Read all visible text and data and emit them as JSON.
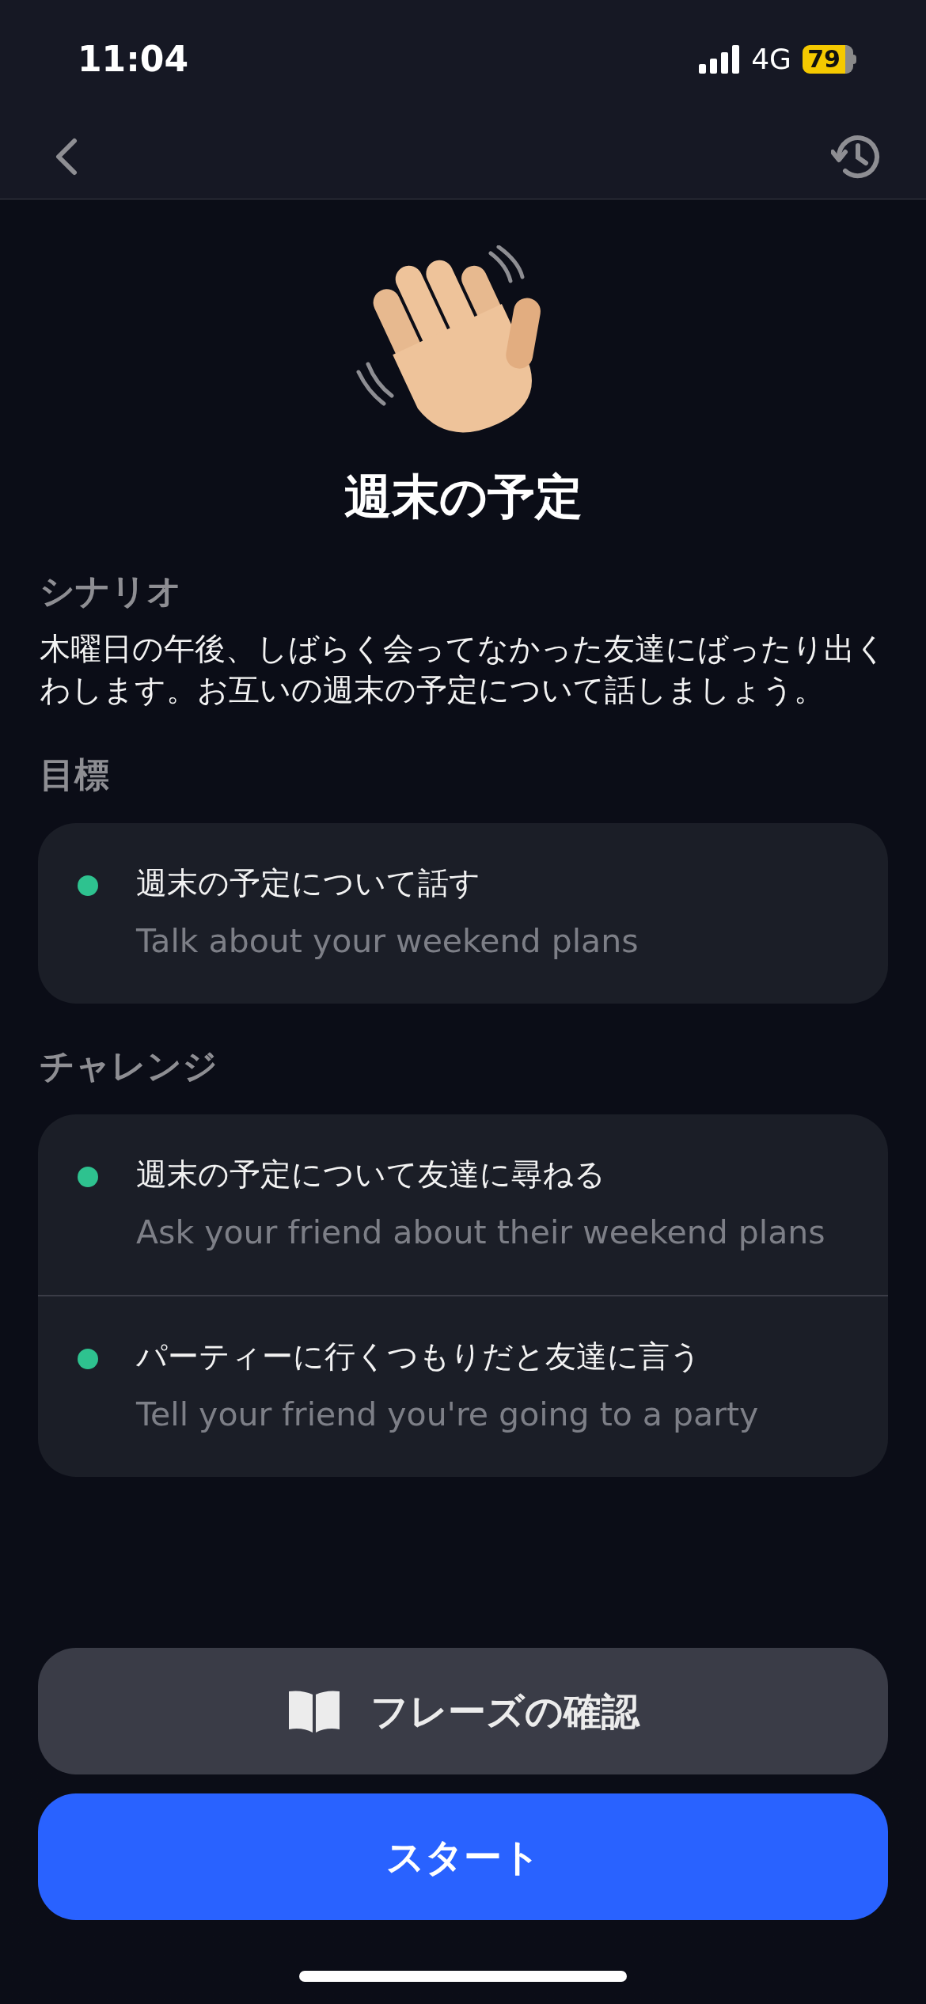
{
  "status_bar": {
    "time": "11:04",
    "network": "4G",
    "battery": "79"
  },
  "title": "週末の予定",
  "scenario": {
    "heading": "シナリオ",
    "text": "木曜日の午後、しばらく会ってなかった友達にばったり出くわします。お互いの週末の予定について話しましょう。"
  },
  "goal": {
    "heading": "目標",
    "items": [
      {
        "text": "週末の予定について話す",
        "translation": "Talk about your weekend plans"
      }
    ]
  },
  "challenge": {
    "heading": "チャレンジ",
    "items": [
      {
        "text": "週末の予定について友達に尋ねる",
        "translation": "Ask your friend about their weekend plans"
      },
      {
        "text": "パーティーに行くつもりだと友達に言う",
        "translation": "Tell your friend you're going to a party"
      }
    ]
  },
  "buttons": [
    {
      "kind": "secondary",
      "label": "フレーズの確認"
    },
    {
      "kind": "primary",
      "label": "スタート"
    }
  ]
}
